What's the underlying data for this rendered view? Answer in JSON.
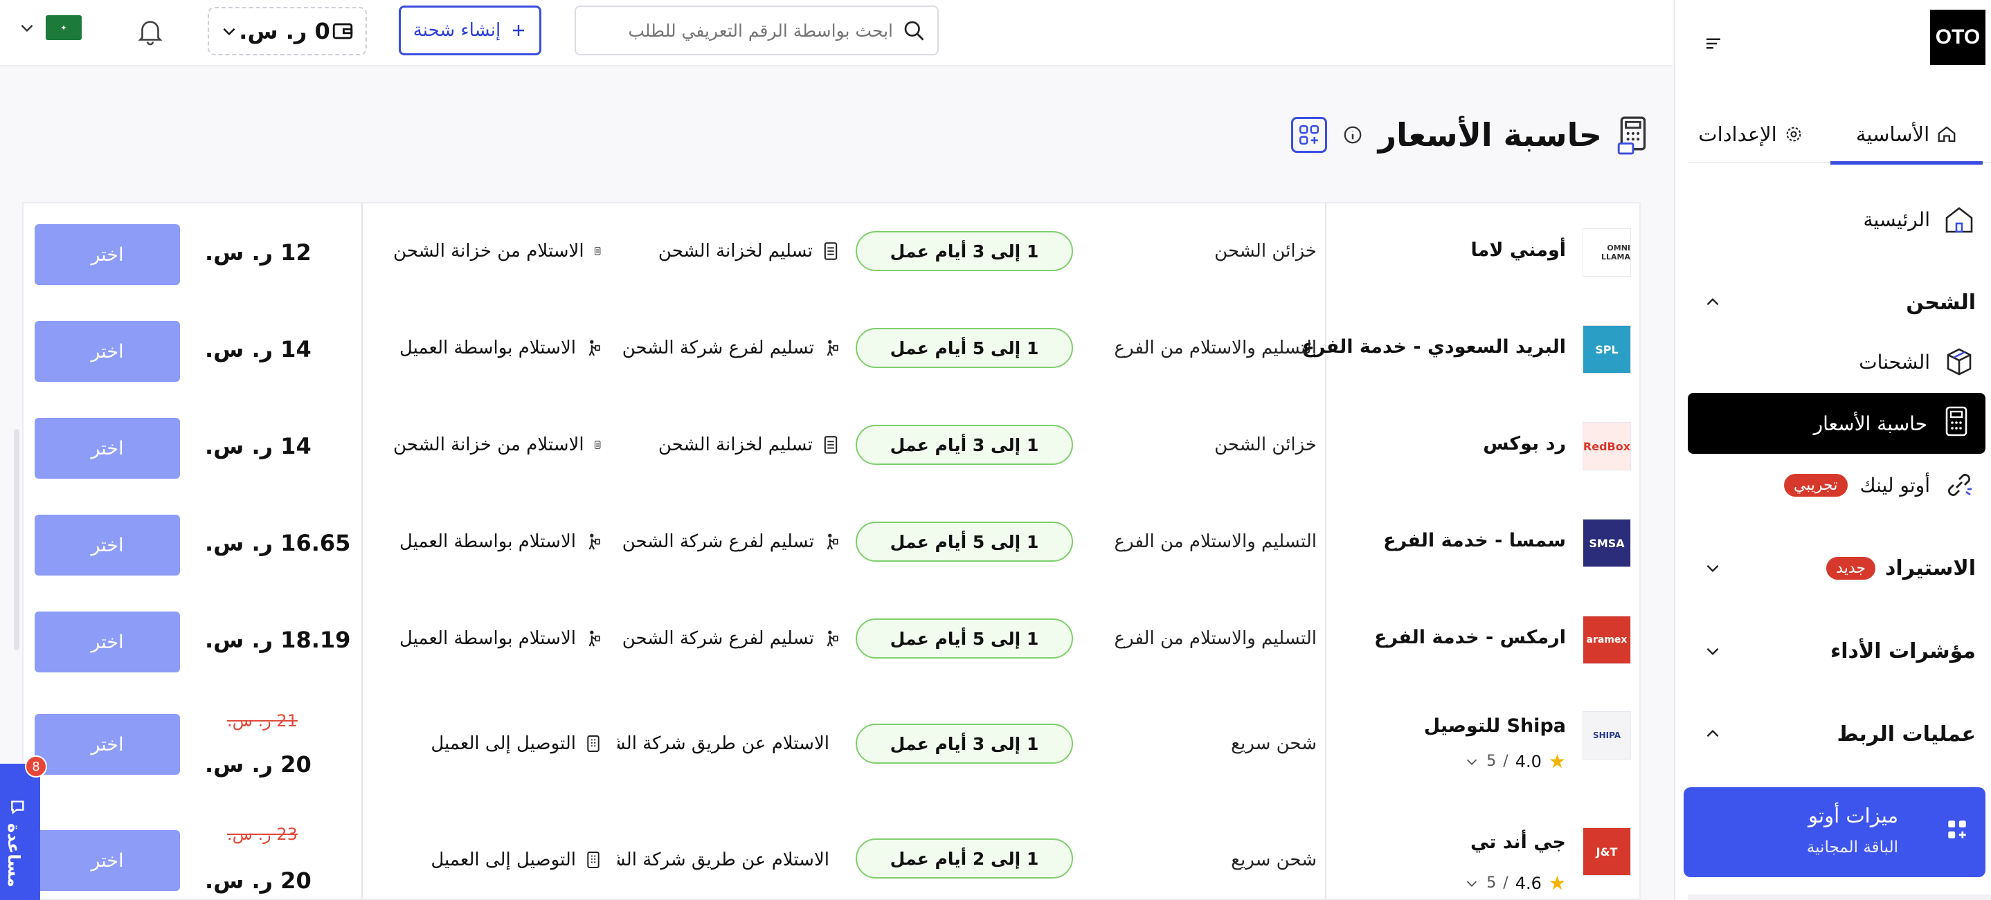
{
  "brand": {
    "logo_text": "OTO"
  },
  "header": {
    "search_placeholder": "ابحث بواسطة الرقم التعريفي للطلب",
    "create_shipment": "إنشاء شحنة",
    "wallet_amount": "0 ر. س."
  },
  "sidebar": {
    "tab_main": "الأساسية",
    "tab_settings": "الإعدادات",
    "home": "الرئيسية",
    "shipping_section": "الشحن",
    "shipments": "الشحنات",
    "price_calculator": "حاسبة الأسعار",
    "oto_link": "أوتو لينك",
    "trial_badge": "تجريبي",
    "import_section": "الاستيراد",
    "new_badge": "جديد",
    "kpi_section": "مؤشرات الأداء",
    "integrations_section": "عمليات الربط",
    "promo_title": "ميزات أوتو",
    "promo_subtitle": "الباقة المجانية"
  },
  "page": {
    "title": "حاسبة الأسعار"
  },
  "help": {
    "label": "مساعدة",
    "count": "8"
  },
  "rows": [
    {
      "logo": "OMNI LLAMA",
      "logo_bg": "#ffffff",
      "logo_fg": "#333333",
      "name": "أومني لاما",
      "service": "خزائن الشحن",
      "days": "1 إلى 3 أيام عمل",
      "delivery": "تسليم لخزانة الشحن",
      "pickup": "الاستلام من خزانة الشحن",
      "price": "12 ر. س.",
      "old_price": "",
      "choose": "اختر"
    },
    {
      "logo": "SPL",
      "logo_bg": "#2a9ec4",
      "logo_fg": "#ffffff",
      "name": "البريد السعودي - خدمة الفرع",
      "service": "التسليم والاستلام من الفرع",
      "days": "1 إلى 5 أيام عمل",
      "delivery": "تسليم لفرع شركة الشحن",
      "pickup": "الاستلام بواسطة العميل",
      "price": "14 ر. س.",
      "old_price": "",
      "choose": "اختر"
    },
    {
      "logo": "RedBox",
      "logo_bg": "#fdecea",
      "logo_fg": "#d6392b",
      "name": "رد بوكس",
      "service": "خزائن الشحن",
      "days": "1 إلى 3 أيام عمل",
      "delivery": "تسليم لخزانة الشحن",
      "pickup": "الاستلام من خزانة الشحن",
      "price": "14 ر. س.",
      "old_price": "",
      "choose": "اختر"
    },
    {
      "logo": "SMSA",
      "logo_bg": "#2b2d7a",
      "logo_fg": "#ffffff",
      "name": "سمسا - خدمة الفرع",
      "service": "التسليم والاستلام من الفرع",
      "days": "1 إلى 5 أيام عمل",
      "delivery": "تسليم لفرع شركة الشحن",
      "pickup": "الاستلام بواسطة العميل",
      "price": "16.65 ر. س.",
      "old_price": "",
      "choose": "اختر"
    },
    {
      "logo": "aramex",
      "logo_bg": "#d6392b",
      "logo_fg": "#ffffff",
      "name": "ارمكس - خدمة الفرع",
      "service": "التسليم والاستلام من الفرع",
      "days": "1 إلى 5 أيام عمل",
      "delivery": "تسليم لفرع شركة الشحن",
      "pickup": "الاستلام بواسطة العميل",
      "price": "18.19 ر. س.",
      "old_price": "",
      "choose": "اختر"
    },
    {
      "logo": "SHIPA",
      "logo_bg": "#f4f4f6",
      "logo_fg": "#2b3a8a",
      "name": "Shipa للتوصيل",
      "service": "شحن سريع",
      "days": "1 إلى 3 أيام عمل",
      "delivery": "الاستلام عن طريق شركة الشحن",
      "pickup": "التوصيل إلى العميل",
      "price": "20 ر. س.",
      "old_price": "21 ر. س.",
      "rating": "4.0",
      "rating_total": "5",
      "choose": "اختر"
    },
    {
      "logo": "J&T",
      "logo_bg": "#d6392b",
      "logo_fg": "#ffffff",
      "name": "جي أند تي",
      "service": "شحن سريع",
      "days": "1 إلى 2 أيام عمل",
      "delivery": "الاستلام عن طريق شركة الشحن",
      "pickup": "التوصيل إلى العميل",
      "price": "20 ر. س.",
      "old_price": "23 ر. س.",
      "rating": "4.6",
      "rating_total": "5",
      "choose": "اختر"
    }
  ]
}
